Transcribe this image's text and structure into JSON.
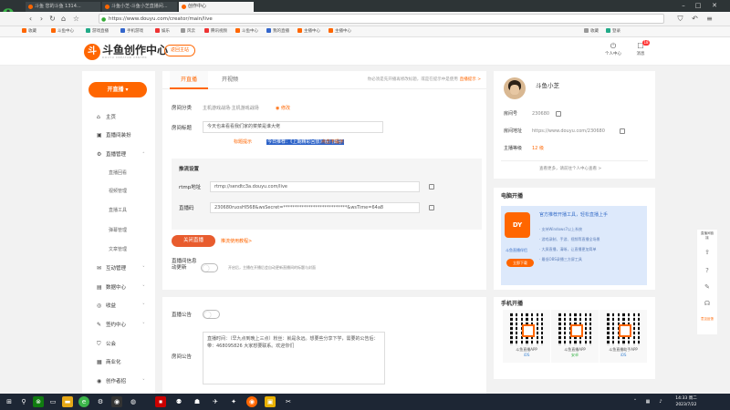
{
  "browser": {
    "tabs": [
      "斗鱼 您的斗鱼 1314...",
      "斗鱼小芝-斗鱼小芝直播间...",
      "创作中心"
    ],
    "url": "https://www.douyu.com/creator/main/live",
    "bookmarks": [
      "收藏",
      "斗鱼中心",
      "游戏直播",
      "手机游戏",
      "娱乐",
      "风云",
      "腾讯视频",
      "斗鱼中心",
      "我的直播",
      "主播中心",
      "主播中心"
    ],
    "toolbar_right": [
      "收藏",
      "登录"
    ]
  },
  "header": {
    "logo_text": "斗鱼创作中心",
    "logo_sub": "DOUYU CREATOR CENTER",
    "back_home": "返回主站",
    "notify_label": "个人中心",
    "message_label": "消息",
    "message_badge": "18"
  },
  "sidebar": {
    "live_button": "开直播",
    "items": [
      {
        "label": "主页",
        "icon": "home-icon"
      },
      {
        "label": "直播间装扮",
        "icon": "tv-icon"
      },
      {
        "label": "直播管理",
        "icon": "gear-icon"
      }
    ],
    "sub_items": [
      "直播回看",
      "视频管理",
      "直播工具",
      "弹幕管理",
      "文章管理"
    ],
    "more_items": [
      {
        "label": "互动管理",
        "icon": "chat-icon"
      },
      {
        "label": "数据中心",
        "icon": "chart-icon"
      },
      {
        "label": "收益",
        "icon": "coin-icon"
      },
      {
        "label": "签约中心",
        "icon": "pen-icon"
      },
      {
        "label": "公会",
        "icon": "shield-icon"
      },
      {
        "label": "商业化",
        "icon": "bag-icon"
      },
      {
        "label": "创作者招",
        "icon": "user-icon"
      }
    ]
  },
  "live": {
    "tabs": [
      "开直播",
      "开视频"
    ],
    "tabs_note": "你必须是先开播再修改标题，或是在提示中是使用",
    "tabs_link": "直播提示 >",
    "room_category_label": "房间分类",
    "room_category_value": "主机游戏战场·主机游戏战场",
    "modify_link": "修改",
    "title_label": "房间标题",
    "title_value": "今天也来看看我们家的菜菜是谁大佬",
    "prompt_label": "标题提示",
    "prompt_highlight": "今日推荐：《上期精彩回放》在门数字",
    "prompt_link": "点击不提示",
    "settings_title": "推流设置",
    "rtmp_label": "rtmp地址",
    "rtmp_value": "rtmp://sendtc3a.douyu.com/live",
    "stream_label": "直播码",
    "stream_value": "230680ruosHl568&wsSecret=****************************&wsTime=64a8",
    "close_button": "关闭直播",
    "tutorial_link": "推流使用教程>",
    "toggle_label": "直播间信息动更新",
    "toggle_note": "开启后，主播在开播后会自动更新直播间的标题与封面"
  },
  "announce": {
    "toggle_label": "直播公告",
    "notice_label": "房间公告",
    "notice_text": "直播时间：（早九点到晚上三点）粉丝：就是永远。想要些分享下学，需要的公告后：带：468095826 大家想要联系。欢迎你们"
  },
  "profile": {
    "name": "斗鱼小芝",
    "rows": [
      {
        "label": "房间号",
        "value": "230680"
      },
      {
        "label": "房间地址",
        "value": "https://www.douyu.com/230680"
      },
      {
        "label": "主播等级",
        "value": "12 级"
      }
    ],
    "footer_link": "查看更多，请前往个人中心查看 >"
  },
  "pc_live": {
    "title": "电脑开播",
    "promo_title": "官方推荐开播工具，轻松直播上手",
    "promo_lines": [
      "· 支持Windows7以上系统",
      "· 游戏录制、手游、视频等直播全场景",
      "· 大屏直播，清晰，让直播更加简单",
      "· 最低OBS录播三方屏工具"
    ],
    "app_name": "斗鱼直播伴侣",
    "download": "立即下载"
  },
  "mobile_live": {
    "title": "手机开播",
    "apps": [
      {
        "name": "斗鱼直播APP",
        "platform": "iOS"
      },
      {
        "name": "斗鱼直播APP",
        "platform": "安卓"
      },
      {
        "name": "斗鱼直播助手APP",
        "platform": "iOS"
      }
    ]
  },
  "float_bar": [
    "直播间链接",
    "帮助",
    "反馈",
    "客服",
    "意见反馈"
  ],
  "taskbar": {
    "time": "14:33 周二",
    "date": "2023/7/22"
  }
}
